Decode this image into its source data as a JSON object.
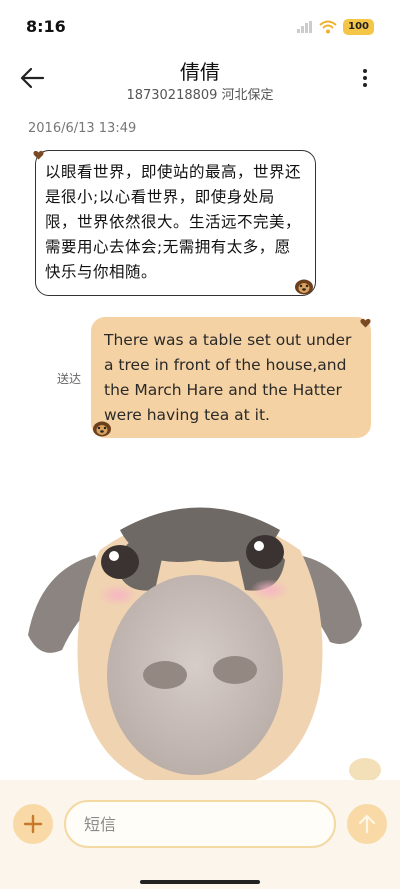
{
  "status_bar": {
    "time": "8:16",
    "battery": "100"
  },
  "header": {
    "contact_name": "倩倩",
    "contact_subtitle": "18730218809 河北保定",
    "back_icon": "arrow-left-icon",
    "more_icon": "more-vertical-icon"
  },
  "conversation": {
    "timestamp": "2016/6/13 13:49",
    "incoming_message": "以眼看世界，即使站的最高，世界还是很小;以心看世界，即使身处局限，世界依然很大。生活远不完美，需要用心去体会;无需拥有太多，愿快乐与你相随。",
    "outgoing_message": "There was a table set out under a tree in front of the house,and the March Hare and the Hatter were having tea at it.",
    "delivery_status": "送达"
  },
  "composer": {
    "placeholder": "短信",
    "add_icon": "plus-icon",
    "send_icon": "arrow-up-icon"
  },
  "colors": {
    "accent": "#f5d2a3",
    "button": "#f9d9a6",
    "brand_brown": "#7a4a26"
  }
}
